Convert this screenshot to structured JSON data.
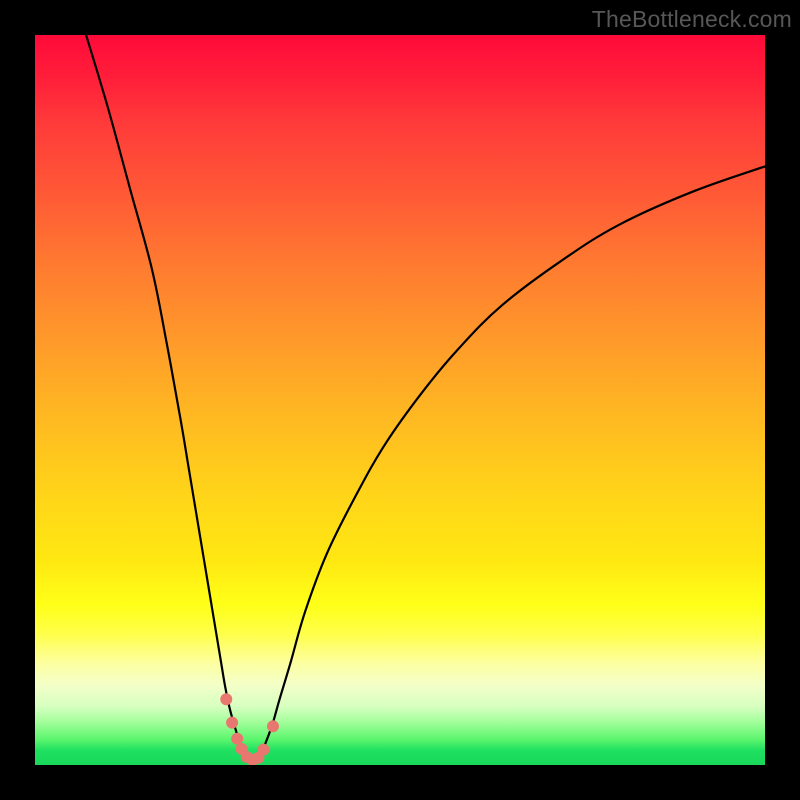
{
  "watermark": "TheBottleneck.com",
  "colors": {
    "page_bg": "#000000",
    "watermark": "#575757",
    "curve_stroke": "#000000",
    "marker_fill": "#e8776f",
    "marker_stroke": "#e8776f"
  },
  "chart_data": {
    "type": "line",
    "title": "",
    "xlabel": "",
    "ylabel": "",
    "xlim": [
      0,
      100
    ],
    "ylim": [
      0,
      100
    ],
    "grid": false,
    "legend": false,
    "series": [
      {
        "name": "bottleneck-curve",
        "x": [
          7,
          10,
          13,
          16,
          18,
          20,
          21,
          22,
          23,
          24,
          25,
          25.5,
          26,
          26.5,
          27,
          27.5,
          28,
          28.5,
          29,
          29.5,
          30,
          30.5,
          31,
          31.5,
          32.5,
          33.5,
          35,
          37,
          40,
          44,
          48,
          53,
          58,
          64,
          72,
          80,
          90,
          100
        ],
        "values": [
          100,
          90,
          79,
          68,
          58,
          47,
          41,
          35,
          29,
          23,
          17,
          14,
          11,
          8.5,
          6.5,
          4.8,
          3.2,
          2.1,
          1.3,
          0.8,
          0.5,
          0.8,
          1.5,
          2.8,
          5.5,
          9,
          14,
          21,
          29,
          37,
          44,
          51,
          57,
          63,
          69,
          74,
          78.5,
          82
        ]
      }
    ],
    "markers": {
      "name": "bottleneck-optimum-points",
      "x": [
        26.2,
        27.0,
        27.7,
        28.3,
        29.0,
        29.8,
        30.6,
        31.3,
        32.6
      ],
      "values": [
        9.0,
        5.8,
        3.6,
        2.2,
        1.1,
        0.7,
        1.0,
        2.1,
        5.3
      ]
    }
  }
}
